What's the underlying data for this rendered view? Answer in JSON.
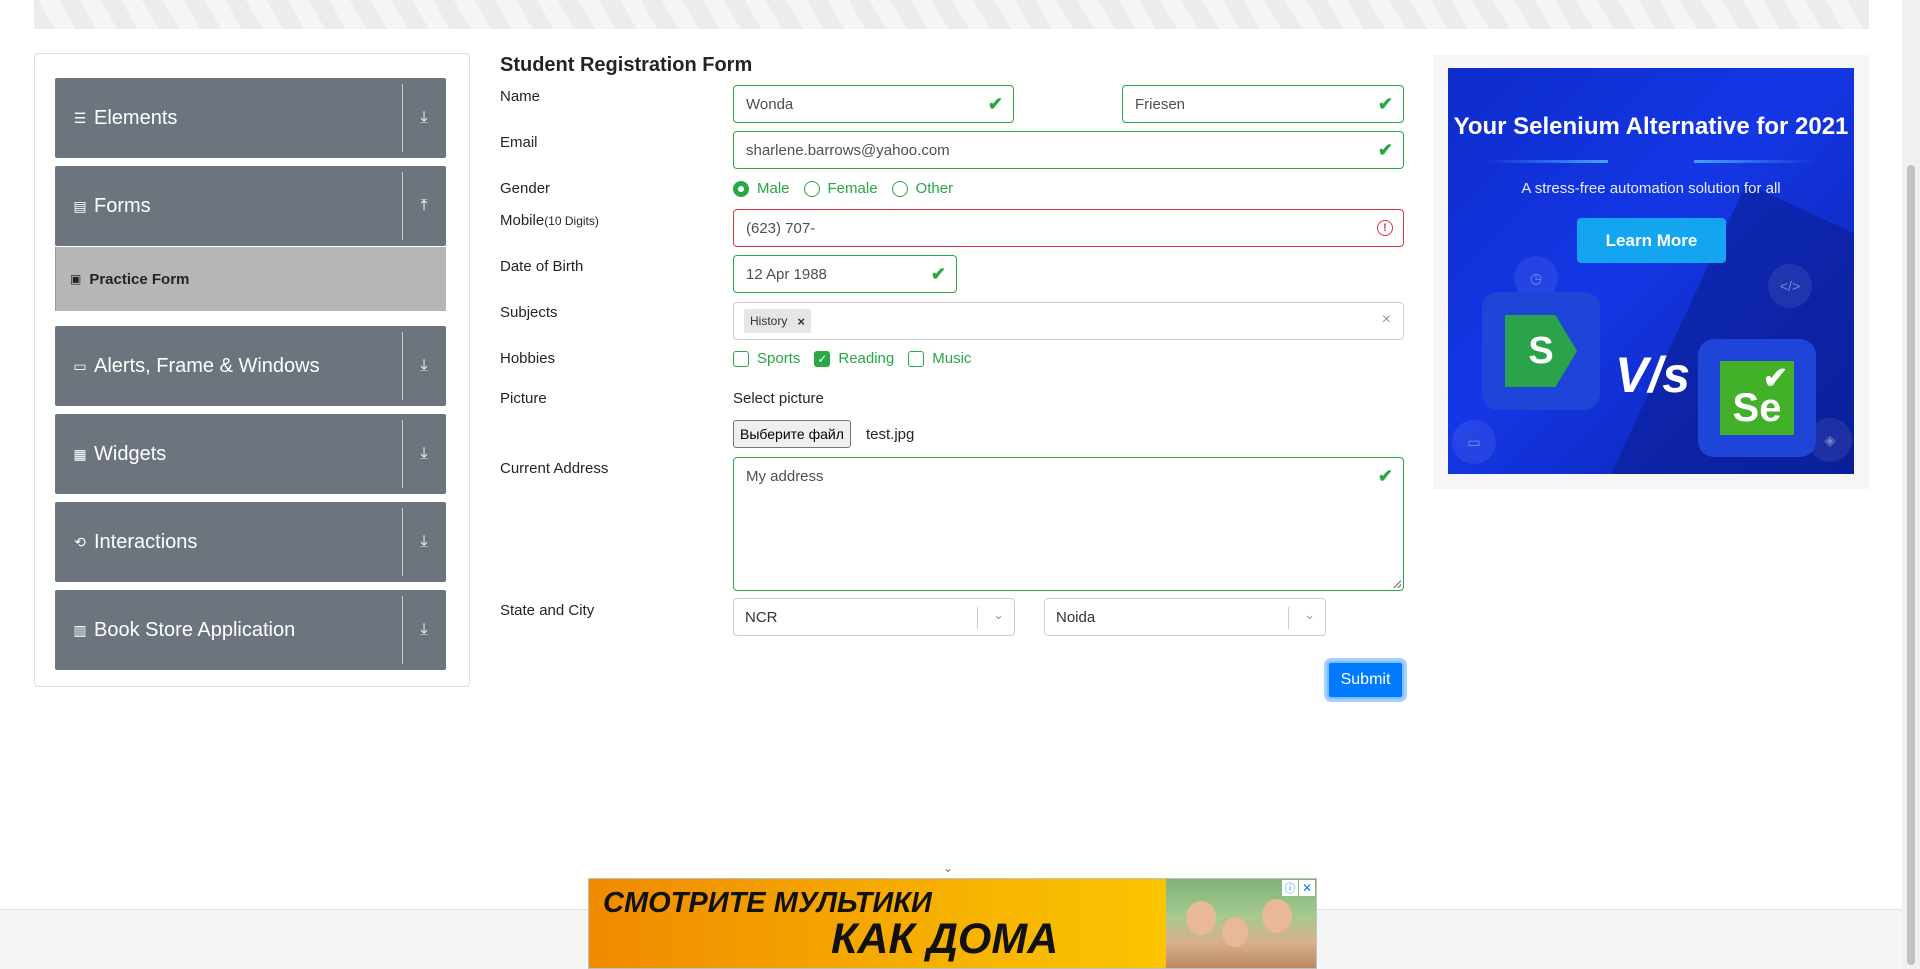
{
  "sidebar": {
    "groups": [
      {
        "label": "Elements",
        "icon": "list-icon",
        "arrow": "download-icon"
      },
      {
        "label": "Forms",
        "icon": "document-icon",
        "arrow": "upload-icon"
      },
      {
        "label": "Alerts, Frame & Windows",
        "icon": "window-icon",
        "arrow": "download-icon"
      },
      {
        "label": "Widgets",
        "icon": "grid-icon",
        "arrow": "download-icon"
      },
      {
        "label": "Interactions",
        "icon": "refresh-icon",
        "arrow": "download-icon"
      },
      {
        "label": "Book Store Application",
        "icon": "books-icon",
        "arrow": "download-icon"
      }
    ],
    "active_item": {
      "label": "Practice Form",
      "icon": "html5-icon"
    }
  },
  "form": {
    "title": "Student Registration Form",
    "labels": {
      "name": "Name",
      "email": "Email",
      "gender": "Gender",
      "mobile": "Mobile",
      "mobile_hint": "(10 Digits)",
      "dob": "Date of Birth",
      "subjects": "Subjects",
      "hobbies": "Hobbies",
      "picture": "Picture",
      "address": "Current Address",
      "state_city": "State and City"
    },
    "first_name": "Wonda",
    "last_name": "Friesen",
    "email": "sharlene.barrows@yahoo.com",
    "gender_options": [
      {
        "label": "Male",
        "selected": true
      },
      {
        "label": "Female",
        "selected": false
      },
      {
        "label": "Other",
        "selected": false
      }
    ],
    "mobile": "(623) 707-",
    "dob": "12 Apr 1988",
    "subjects": [
      "History"
    ],
    "hobbies": [
      {
        "label": "Sports",
        "checked": false
      },
      {
        "label": "Reading",
        "checked": true
      },
      {
        "label": "Music",
        "checked": false
      }
    ],
    "picture_label": "Select picture",
    "file_button": "Выберите файл",
    "file_name": "test.jpg",
    "address": "My address",
    "state": "NCR",
    "city": "Noida",
    "submit": "Submit",
    "colors": {
      "valid": "#28a745",
      "invalid": "#dc3545",
      "primary": "#007bff"
    }
  },
  "ad_right": {
    "title": "Your Selenium Alternative for 2021",
    "subtitle": "A stress-free automation solution for all",
    "button": "Learn More",
    "vs": "V/s",
    "logo_left": "S",
    "logo_right": "Se"
  },
  "ad_bottom": {
    "line1": "СМОТРИТЕ МУЛЬТИКИ",
    "line2": "КАК ДОМА"
  }
}
